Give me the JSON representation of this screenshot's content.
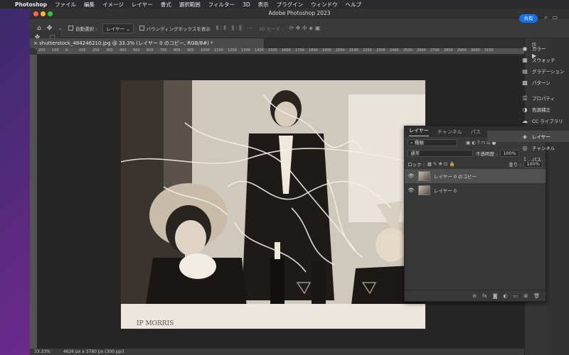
{
  "menubar": {
    "app": "Photoshop",
    "items": [
      "ファイル",
      "編集",
      "イメージ",
      "レイヤー",
      "書式",
      "選択範囲",
      "フィルター",
      "3D",
      "表示",
      "プラグイン",
      "ウィンドウ",
      "ヘルプ"
    ]
  },
  "window": {
    "title": "Adobe Photoshop 2023"
  },
  "options": {
    "auto_select_label": "自動選択 :",
    "auto_select_value": "レイヤー",
    "bbox_label": "バウンディングボックスを表示",
    "mode_3d_label": "3D モード :",
    "share_label": "共有"
  },
  "document": {
    "tab_title": "shutterstock_484246210.jpg @ 33.3% (レイヤー 0 のコピー, RGB/8#) *"
  },
  "ruler": [
    "200",
    "100",
    "0",
    "100",
    "200",
    "300",
    "400",
    "500",
    "600",
    "700",
    "800",
    "900",
    "1000",
    "1100",
    "1200",
    "1300",
    "1400",
    "1500",
    "1600",
    "1700",
    "1800",
    "1900",
    "2000",
    "2100",
    "2200",
    "2300",
    "2400",
    "2500",
    "2600",
    "2700",
    "2800",
    "2900",
    "3000",
    "3100"
  ],
  "status": {
    "zoom": "33.33%",
    "doc_info": "4626 px x 3780 px (300 ppi)"
  },
  "layers_panel": {
    "tabs": [
      "レイヤー",
      "チャンネル",
      "パス"
    ],
    "filter_label": "種類",
    "blend_mode": "通常",
    "opacity_label": "不透明度 :",
    "opacity_value": "100%",
    "lock_label": "ロック :",
    "fill_label": "塗り :",
    "fill_value": "100%",
    "layers": [
      "レイヤー 0 のコピー",
      "レイヤー 0"
    ],
    "footer_fx": "fx"
  },
  "right_panels": {
    "group1": [
      "カラー",
      "スウォッチ",
      "グラデーション",
      "パターン"
    ],
    "group2": [
      "プロパティ",
      "色調補正",
      "CC ライブラリ"
    ],
    "group3": [
      "レイヤー",
      "チャンネル",
      "パス"
    ]
  },
  "photo": {
    "watermark": "IP MORRIS"
  }
}
